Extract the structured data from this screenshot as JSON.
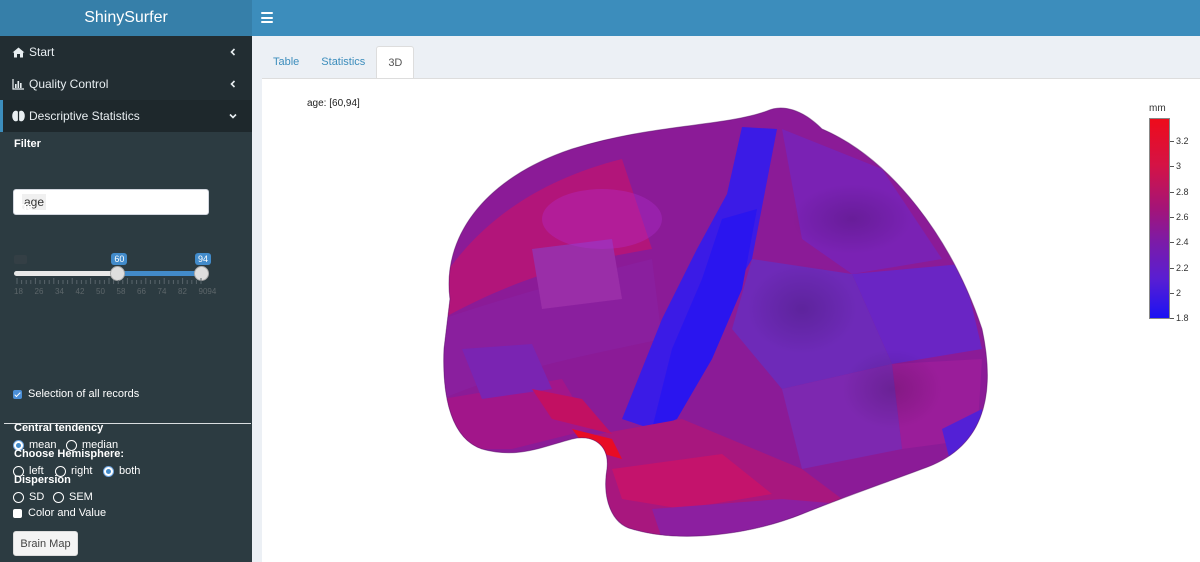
{
  "app": {
    "title": "ShinySurfer"
  },
  "sidebar": {
    "items": [
      {
        "label": "Start",
        "icon": "home-icon"
      },
      {
        "label": "Quality Control",
        "icon": "bar-chart-icon"
      },
      {
        "label": "Descriptive Statistics",
        "icon": "brain-icon"
      }
    ]
  },
  "filter": {
    "label": "Filter",
    "value": "age"
  },
  "age_slider": {
    "label": "age",
    "min_value": "60",
    "max_value": "94",
    "range_min": 18,
    "range_max": 94,
    "selected_min": 60,
    "selected_max": 94,
    "ticks": [
      "18",
      "26",
      "34",
      "42",
      "50",
      "58",
      "66",
      "74",
      "82",
      "9094"
    ]
  },
  "selection_all": {
    "label": "Selection of all records",
    "checked": true
  },
  "central_tendency": {
    "label": "Central tendency",
    "options": [
      "mean",
      "median"
    ],
    "selected": "mean"
  },
  "dispersion": {
    "label": "Dispersion",
    "options": [
      "SD",
      "SEM"
    ],
    "selected": null
  },
  "hemisphere": {
    "label": "Choose Hemisphere:",
    "options": [
      "left",
      "right",
      "both"
    ],
    "selected": "both"
  },
  "color_value": {
    "label": "Color and Value",
    "checked": false
  },
  "brain_map_button": "Brain Map",
  "tabs": [
    "Table",
    "Statistics",
    "3D"
  ],
  "active_tab": "3D",
  "plot": {
    "annotation": "age: [60,94]",
    "colorbar_title": "mm",
    "colorbar_ticks": [
      "3.2",
      "3",
      "2.8",
      "2.6",
      "2.4",
      "2.2",
      "2",
      "1.8"
    ],
    "colors": {
      "high": "#ee0b1b",
      "low": "#1b12f3"
    }
  },
  "colors": {
    "header": "#3c8dbc",
    "logo_bg": "#367fa9",
    "sidebar": "#222d32",
    "accent": "#428bca"
  }
}
